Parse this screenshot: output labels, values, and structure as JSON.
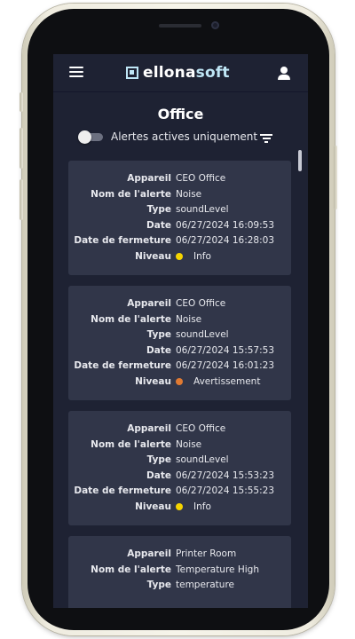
{
  "header": {
    "logo_part1": "ellona",
    "logo_part2": "soft"
  },
  "page": {
    "title": "Office"
  },
  "filter": {
    "toggle_label": "Alertes actives uniquement",
    "toggle_on": false
  },
  "labels": {
    "device": "Appareil",
    "alert_name": "Nom de l'alerte",
    "type": "Type",
    "date": "Date",
    "close_date": "Date de fermeture",
    "level": "Niveau"
  },
  "alerts": [
    {
      "device": "CEO Office",
      "alert_name": "Noise",
      "type": "soundLevel",
      "date": "06/27/2024 16:09:53",
      "close_date": "06/27/2024 16:28:03",
      "level": "Info",
      "level_color": "#f5d400"
    },
    {
      "device": "CEO Office",
      "alert_name": "Noise",
      "type": "soundLevel",
      "date": "06/27/2024 15:57:53",
      "close_date": "06/27/2024 16:01:23",
      "level": "Avertissement",
      "level_color": "#e07a32"
    },
    {
      "device": "CEO Office",
      "alert_name": "Noise",
      "type": "soundLevel",
      "date": "06/27/2024 15:53:23",
      "close_date": "06/27/2024 15:55:23",
      "level": "Info",
      "level_color": "#f5d400"
    },
    {
      "device": "Printer Room",
      "alert_name": "Temperature High",
      "type": "temperature",
      "date": "",
      "close_date": "",
      "level": "",
      "level_color": ""
    }
  ],
  "colors": {
    "screen_bg": "#1e2233",
    "card_bg": "#313649",
    "logo_accent": "#bfe6f6"
  },
  "icons": {
    "menu": "hamburger-menu-icon",
    "user": "user-icon",
    "filter": "filter-icon",
    "logo": "ellonasoft-logo-mark"
  }
}
